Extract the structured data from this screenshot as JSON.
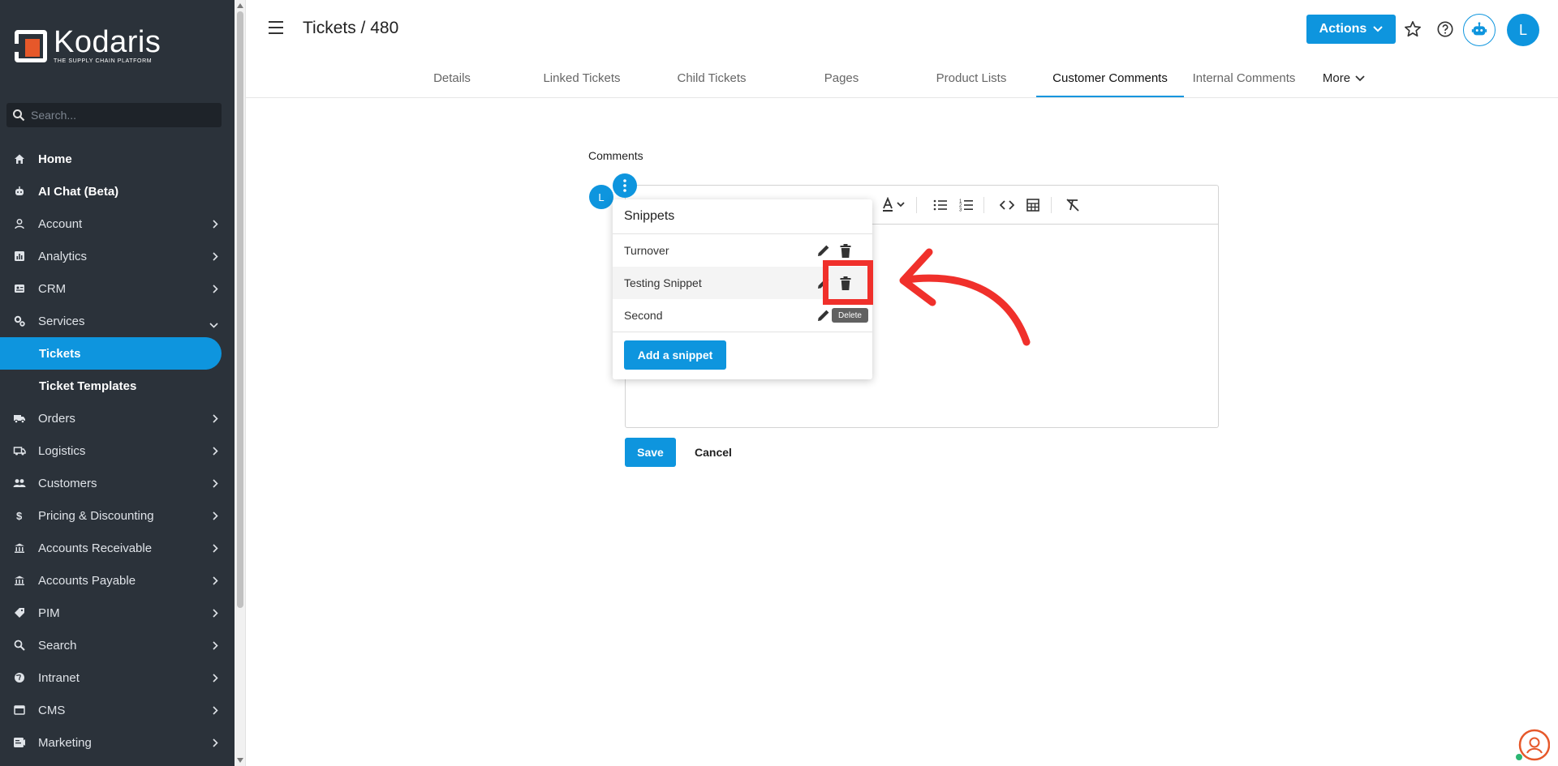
{
  "sidebar": {
    "logo": {
      "name": "Kodaris",
      "tagline": "THE SUPPLY CHAIN PLATFORM"
    },
    "search_placeholder": "Search...",
    "items": [
      {
        "label": "Home",
        "icon": "home-icon",
        "chevron": "none"
      },
      {
        "label": "AI Chat (Beta)",
        "icon": "robot-icon",
        "chevron": "none"
      },
      {
        "label": "Account",
        "icon": "person-icon",
        "chevron": "right"
      },
      {
        "label": "Analytics",
        "icon": "chart-icon",
        "chevron": "right"
      },
      {
        "label": "CRM",
        "icon": "contact-card-icon",
        "chevron": "right"
      },
      {
        "label": "Services",
        "icon": "gears-icon",
        "chevron": "down"
      },
      {
        "label": "Tickets",
        "icon": "",
        "chevron": "none",
        "active": true,
        "sub": true
      },
      {
        "label": "Ticket Templates",
        "icon": "",
        "chevron": "none",
        "sub": true
      },
      {
        "label": "Orders",
        "icon": "truck-icon",
        "chevron": "right"
      },
      {
        "label": "Logistics",
        "icon": "shipping-icon",
        "chevron": "right"
      },
      {
        "label": "Customers",
        "icon": "people-icon",
        "chevron": "right"
      },
      {
        "label": "Pricing & Discounting",
        "icon": "dollar-icon",
        "chevron": "right"
      },
      {
        "label": "Accounts Receivable",
        "icon": "bank-icon",
        "chevron": "right"
      },
      {
        "label": "Accounts Payable",
        "icon": "bank-icon",
        "chevron": "right"
      },
      {
        "label": "PIM",
        "icon": "tag-icon",
        "chevron": "right"
      },
      {
        "label": "Search",
        "icon": "search-icon",
        "chevron": "right"
      },
      {
        "label": "Intranet",
        "icon": "globe-icon",
        "chevron": "right"
      },
      {
        "label": "CMS",
        "icon": "web-icon",
        "chevron": "right"
      },
      {
        "label": "Marketing",
        "icon": "campaign-icon",
        "chevron": "right"
      }
    ]
  },
  "header": {
    "title": "Tickets / 480",
    "actions_label": "Actions",
    "avatar_initial": "L"
  },
  "tabs": [
    {
      "label": "Details"
    },
    {
      "label": "Linked Tickets"
    },
    {
      "label": "Child Tickets"
    },
    {
      "label": "Pages"
    },
    {
      "label": "Product Lists"
    },
    {
      "label": "Customer Comments",
      "active": true
    },
    {
      "label": "Internal Comments"
    },
    {
      "label": "More"
    }
  ],
  "comments": {
    "label": "Comments",
    "user_initial": "L",
    "save_label": "Save",
    "cancel_label": "Cancel"
  },
  "snippets": {
    "title": "Snippets",
    "items": [
      {
        "name": "Turnover"
      },
      {
        "name": "Testing Snippet",
        "hovered": true
      },
      {
        "name": "Second"
      }
    ],
    "add_label": "Add a snippet",
    "tooltip": "Delete"
  },
  "colors": {
    "accent": "#0e95de",
    "sidebar_bg": "#2b323a",
    "annotation": "#f0302b"
  }
}
